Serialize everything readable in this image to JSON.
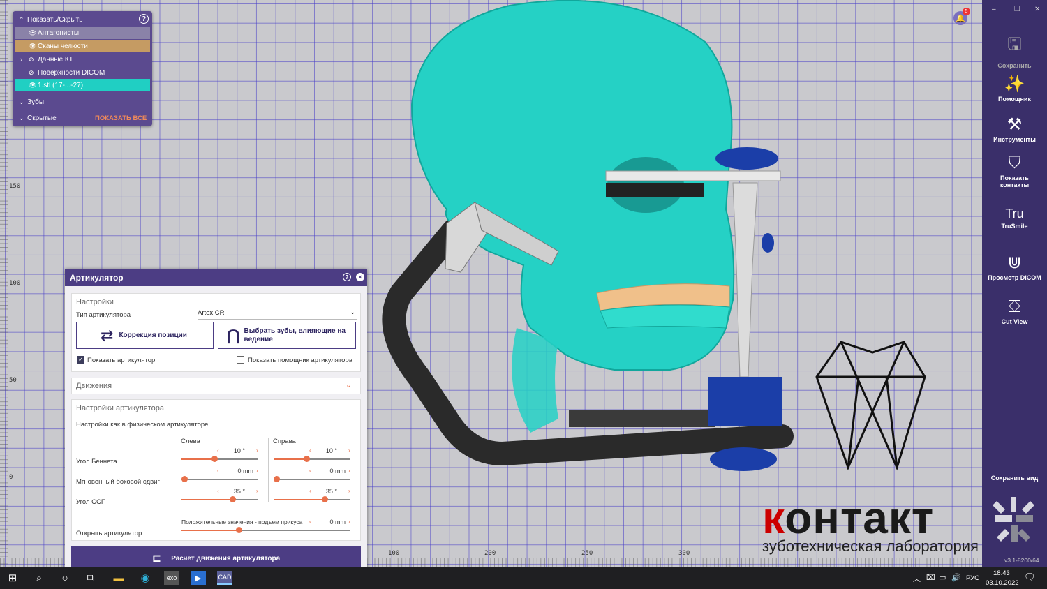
{
  "showhide": {
    "title": "Показать/Скрыть",
    "items": [
      {
        "label": "Антагонисты"
      },
      {
        "label": "Сканы челюсти"
      },
      {
        "label": "Данные КТ"
      },
      {
        "label": "Поверхности DICOM"
      },
      {
        "label": "1.stl (17-...-27)"
      }
    ],
    "teeth": "Зубы",
    "hidden": "Скрытые",
    "show_all": "ПОКАЗАТЬ ВСЕ"
  },
  "notifications": {
    "count": "5"
  },
  "articulator": {
    "title": "Артикулятор",
    "settings": {
      "title": "Настройки",
      "type_label": "Тип артикулятора",
      "type_value": "Artex CR",
      "btn_correction": "Коррекция позиции",
      "btn_select_teeth": "Выбрать зубы, влияющие на ведение",
      "show_articulator": "Показать артикулятор",
      "show_assistant": "Показать помощник артикулятора"
    },
    "movements": "Движения",
    "artic_settings": {
      "title": "Настройки артикулятора",
      "subtitle": "Настройки как в физическом артикуляторе",
      "left": "Слева",
      "right": "Справа",
      "bennett": "Угол Беннета",
      "bennett_left": "10 °",
      "bennett_right": "10 °",
      "shift": "Мгновенный боковой сдвиг",
      "shift_left": "0 mm",
      "shift_right": "0 mm",
      "ssp": "Угол ССП",
      "ssp_left": "35 °",
      "ssp_right": "35 °",
      "open_hint": "Положительные значения - подъем прикуса",
      "open_label": "Открыть артикулятор",
      "open_value": "0 mm"
    },
    "calc_button": "Расчет движения артикулятора"
  },
  "toolbar": {
    "save": "Сохранить",
    "assistant": "Помощник",
    "tools": "Инструменты",
    "contacts": "Показать контакты",
    "trusmile": "TruSmile",
    "dicom": "Просмотр DICOM",
    "cutview": "Cut View",
    "save_view": "Сохранить вид",
    "version": "v3.1-8200/64"
  },
  "brand": {
    "big_k": "к",
    "big_rest": "онтакт",
    "small": "зуботехническая лаборатория"
  },
  "rulers": {
    "left": [
      "150",
      "100",
      "50",
      "0"
    ],
    "bottom": [
      "100",
      "200",
      "250",
      "300"
    ]
  },
  "taskbar": {
    "lang": "РУС",
    "time": "18:43",
    "date": "03.10.2022"
  }
}
